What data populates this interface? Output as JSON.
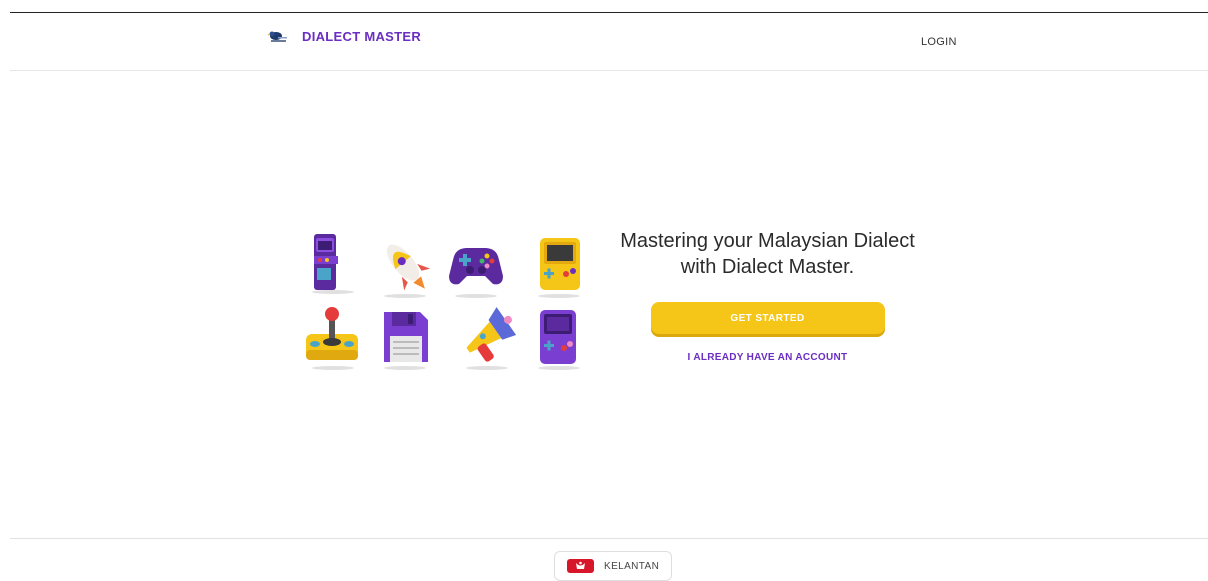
{
  "header": {
    "brand_name": "DIALECT MASTER",
    "login_label": "LOGIN",
    "logo_icon": "bird-logo-icon"
  },
  "hero": {
    "headline_line1": "Mastering your Malaysian Dialect",
    "headline_line2": "with Dialect Master.",
    "cta_label": "GET STARTED",
    "secondary_label": "I ALREADY HAVE AN ACCOUNT",
    "illustrations": [
      "arcade-cabinet-icon",
      "rocket-icon",
      "gamepad-icon",
      "handheld-arcade-icon",
      "joystick-icon",
      "floppy-disk-icon",
      "ray-gun-icon",
      "handheld-console-icon"
    ]
  },
  "footer": {
    "region_label": "KELANTAN",
    "region_flag_icon": "kelantan-flag-icon"
  },
  "colors": {
    "brand_purple": "#6a2ec2",
    "cta_yellow": "#f5c518",
    "flag_red": "#d8162a"
  }
}
